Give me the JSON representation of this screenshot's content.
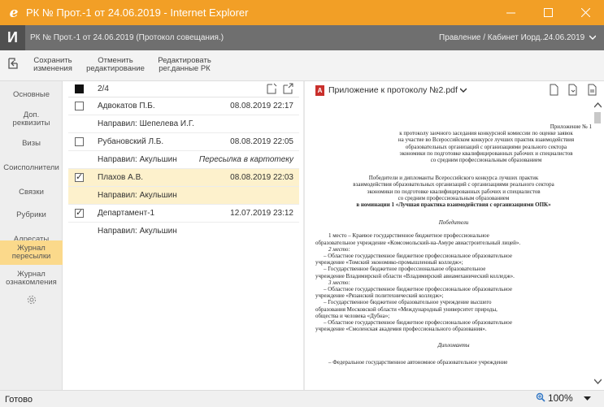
{
  "window": {
    "title": "РК № Прот.-1 от 24.06.2019 - Internet Explorer",
    "logo_letter": "e"
  },
  "appbar": {
    "logo": "И",
    "doc_title": "РК № Прот.-1 от 24.06.2019 (Протокол совещания.)",
    "user": "Правление / Кабинет Иорд...",
    "date": "24.06.2019"
  },
  "toolbar": {
    "save": [
      "Сохранить",
      "изменения"
    ],
    "cancel": [
      "Отменить",
      "редактирование"
    ],
    "edit_reg": [
      "Редактировать",
      "рег.данные РК"
    ]
  },
  "sidebar": {
    "items": [
      [
        "Основные"
      ],
      [
        "Доп.",
        "реквизиты"
      ],
      [
        "Визы"
      ],
      [
        "Соисполнители"
      ],
      [
        "Связки"
      ],
      [
        "Рубрики"
      ],
      [
        "Адресаты"
      ],
      [
        "Журнал",
        "пересылки"
      ],
      [
        "Журнал",
        "ознакомления"
      ]
    ]
  },
  "list": {
    "counter": "2/4",
    "rows": [
      {
        "name": "Адвокатов П.Б.",
        "date": "08.08.2019 22:17",
        "note": ""
      },
      {
        "name": "Направил: Шепелева И.Г.",
        "date": "",
        "note": ""
      },
      {
        "name": "Рубановский Л.Б.",
        "date": "08.08.2019 22:05",
        "note": ""
      },
      {
        "name": "Направил: Акульшин",
        "date": "",
        "note": "Пересылка в картотеку"
      },
      {
        "name": "Плахов А.В.",
        "date": "08.08.2019 22:03",
        "note": ""
      },
      {
        "name": "Направил: Акульшин",
        "date": "",
        "note": ""
      },
      {
        "name": "Департамент-1",
        "date": "12.07.2019 23:12",
        "note": ""
      },
      {
        "name": "Направил: Акульшин",
        "date": "",
        "note": ""
      }
    ]
  },
  "document": {
    "file_name": "Приложение к протоколу №2.pdf",
    "pdf_badge": "A",
    "app_no": "Приложение № 1",
    "head_lines": [
      "к протоколу заочного заседания конкурсной комиссии по оценке заявок",
      "на участие во Всероссийском конкурсе лучших практик взаимодействия",
      "образовательных организаций с организациями реального сектора",
      "экономики по подготовке квалифицированных рабочих и специалистов",
      "со средним профессиональным образованием"
    ],
    "intro_lines": [
      "Победители и дипломанты Всероссийского конкурса лучших практик",
      "взаимодействия образовательных организаций с организациями реального сектора",
      "экономики по подготовке квалифицированных рабочих и специалистов",
      "со средним профессиональным образованием"
    ],
    "nomination": "в номинации 1 «Лучшая практика взаимодействия с организациями ОПК»",
    "winners_title": "Победители",
    "body_lines": [
      "1 место – Краевое государственное бюджетное профессиональное",
      "образовательное учреждение «Комсомольский-на-Амуре авиастроительный лицей».",
      "2 место:",
      "– Областное государственное бюджетное профессиональное образовательное",
      "учреждение «Томский экономико-промышленный колледж»;",
      "– Государственное бюджетное профессиональное образовательное",
      "учреждение Владимирской области «Владимирский авиамеханический колледж».",
      "3 место:",
      "– Областное государственное бюджетное профессиональное образовательное",
      "учреждение «Рязанский политехнический колледж»;",
      "– Государственное бюджетное образовательное учреждение высшего",
      "образования Московской области «Международный университет природы,",
      "общества и человека «Дубна»;",
      "– Областное государственное бюджетное профессиональное образовательное",
      "учреждение «Смоленская академия профессионального образования»."
    ],
    "diplomants_title": "Дипломанты",
    "last_line": "– Федеральное государственное автономное образовательное учреждение"
  },
  "status": {
    "text": "Готово",
    "zoom": "100%"
  }
}
